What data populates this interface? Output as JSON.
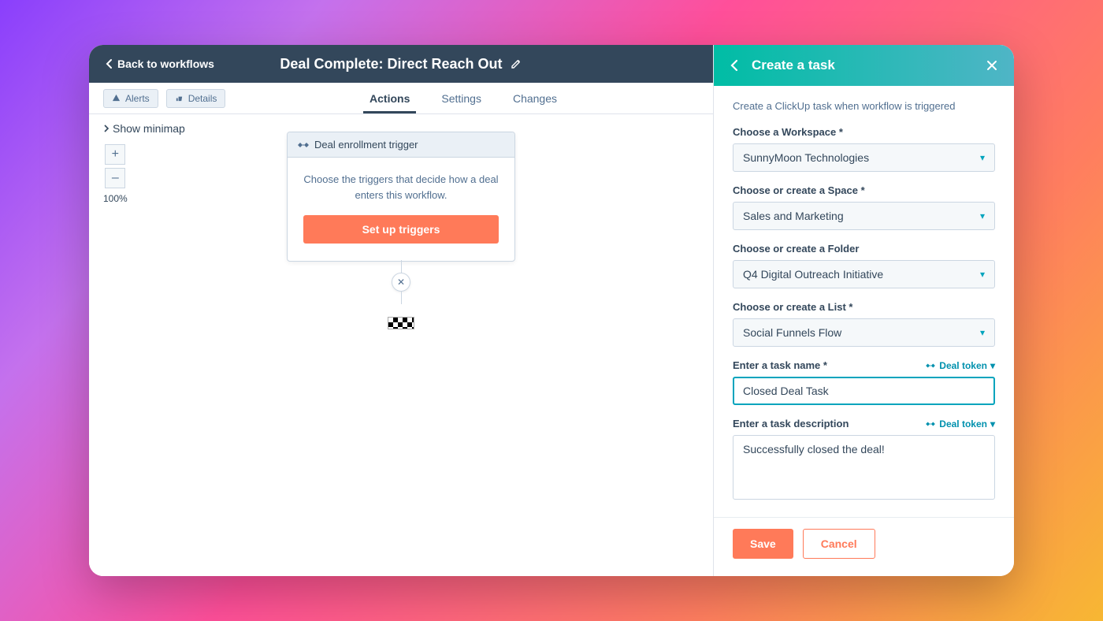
{
  "header": {
    "back_label": "Back to workflows",
    "title": "Deal Complete: Direct Reach Out"
  },
  "toolbar": {
    "alerts_label": "Alerts",
    "details_label": "Details"
  },
  "tabs": {
    "actions": "Actions",
    "settings": "Settings",
    "changes": "Changes"
  },
  "canvas": {
    "minimap_label": "Show minimap",
    "zoom_percent": "100%",
    "node_header": "Deal enrollment trigger",
    "node_text": "Choose the triggers that decide how a deal enters this workflow.",
    "node_button": "Set up triggers"
  },
  "panel": {
    "title": "Create a task",
    "description": "Create a ClickUp task when workflow is triggered",
    "workspace_label": "Choose a Workspace *",
    "workspace_value": "SunnyMoon Technologies",
    "space_label": "Choose or create a Space *",
    "space_value": "Sales and Marketing",
    "folder_label": "Choose or create a Folder",
    "folder_value": "Q4 Digital Outreach Initiative",
    "list_label": "Choose or create a List *",
    "list_value": "Social Funnels Flow",
    "taskname_label": "Enter a task name *",
    "taskname_value": "Closed Deal Task",
    "taskdesc_label": "Enter a task description",
    "taskdesc_value": "Successfully closed the deal!",
    "deal_token_label": "Deal token",
    "save_label": "Save",
    "cancel_label": "Cancel"
  }
}
